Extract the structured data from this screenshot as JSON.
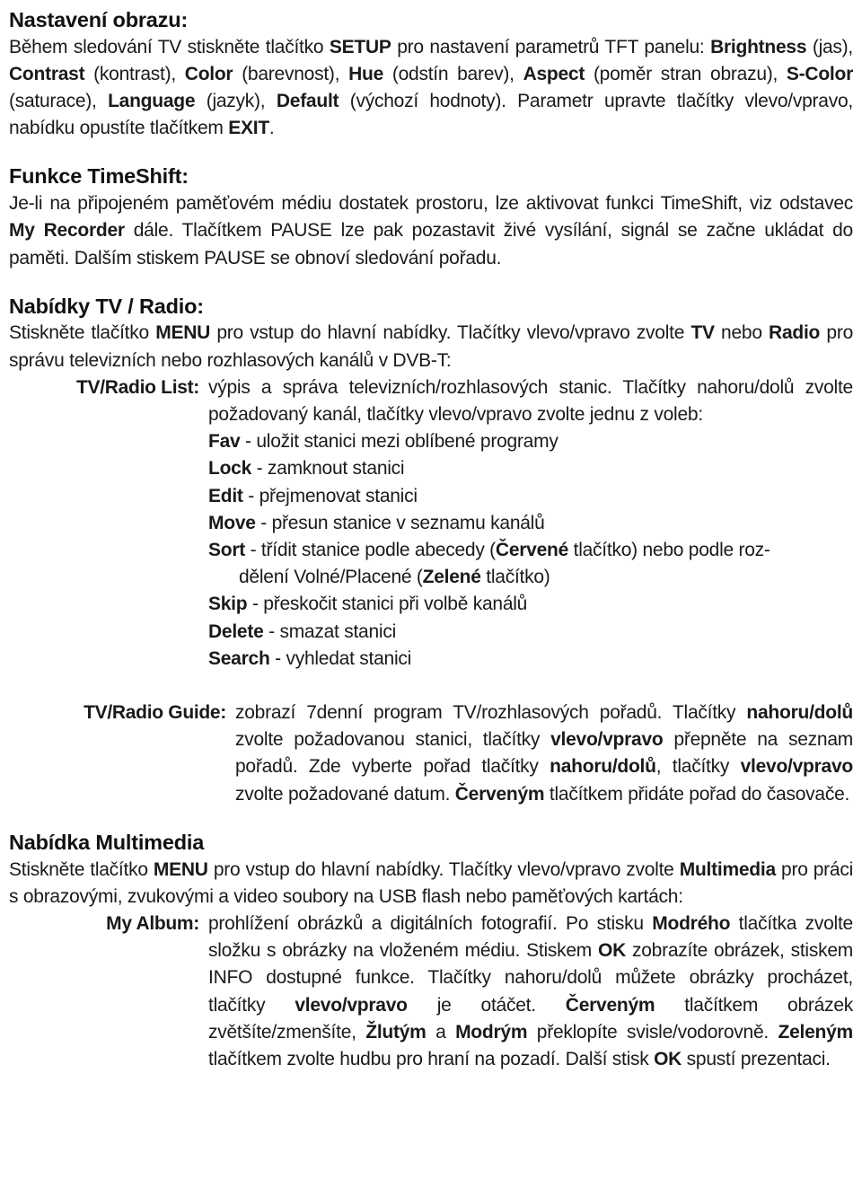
{
  "document": {
    "language": "cs",
    "background_color": "#ffffff",
    "text_color": "#1a1a1a"
  },
  "sections": {
    "picture_settings": {
      "heading": "Nastavení obrazu:",
      "body_parts": [
        {
          "text": "Během sledování TV stiskněte tlačítko ",
          "bold": false
        },
        {
          "text": "SETUP",
          "bold": true
        },
        {
          "text": " pro nastavení parametrů TFT panelu: ",
          "bold": false
        },
        {
          "text": "Brightness",
          "bold": true
        },
        {
          "text": " (jas), ",
          "bold": false
        },
        {
          "text": "Contrast",
          "bold": true
        },
        {
          "text": " (kontrast), ",
          "bold": false
        },
        {
          "text": "Color",
          "bold": true
        },
        {
          "text": " (barevnost), ",
          "bold": false
        },
        {
          "text": "Hue",
          "bold": true
        },
        {
          "text": " (odstín barev), ",
          "bold": false
        },
        {
          "text": "Aspect",
          "bold": true
        },
        {
          "text": " (poměr stran obrazu), ",
          "bold": false
        },
        {
          "text": "S-Color",
          "bold": true
        },
        {
          "text": " (saturace), ",
          "bold": false
        },
        {
          "text": "Language",
          "bold": true
        },
        {
          "text": " (jazyk), ",
          "bold": false
        },
        {
          "text": "Default",
          "bold": true
        },
        {
          "text": " (výchozí hodnoty). Parametr upravte tlačítky vlevo/vpravo, nabídku opustíte tlačítkem ",
          "bold": false
        },
        {
          "text": "EXIT",
          "bold": true
        },
        {
          "text": ".",
          "bold": false
        }
      ]
    },
    "timeshift": {
      "heading": "Funkce TimeShift:",
      "body_parts": [
        {
          "text": "Je-li na připojeném paměťovém médiu dostatek prostoru, lze aktivovat funkci TimeShift, viz odstavec ",
          "bold": false
        },
        {
          "text": "My Recorder",
          "bold": true
        },
        {
          "text": " dále. Tlačítkem PAUSE lze pak pozastavit živé vysílání, signál se začne ukládat do paměti. Dalším stiskem PAUSE se obnoví sledování pořadu.",
          "bold": false
        }
      ]
    },
    "tv_radio_menus": {
      "heading": "Nabídky TV / Radio:",
      "intro_parts": [
        {
          "text": "Stiskněte tlačítko ",
          "bold": false
        },
        {
          "text": "MENU",
          "bold": true
        },
        {
          "text": " pro vstup do hlavní nabídky. Tlačítky vlevo/vpravo zvolte ",
          "bold": false
        },
        {
          "text": "TV",
          "bold": true
        },
        {
          "text": " nebo ",
          "bold": false
        },
        {
          "text": "Radio",
          "bold": true
        },
        {
          "text": " pro správu televizních nebo rozhlasových kanálů v DVB-T:",
          "bold": false
        }
      ],
      "list_entry": {
        "label": "TV/Radio List:",
        "body_parts": [
          {
            "text": "výpis a správa televizních/rozhlasových stanic. Tlačítky nahoru/dolů zvolte požadovaný kanál, tlačítky vlevo/vpravo zvolte jednu z voleb:",
            "bold": false
          }
        ],
        "options": [
          {
            "name": "Fav",
            "desc": " - uložit stanici mezi oblíbené programy",
            "continuation": ""
          },
          {
            "name": "Lock",
            "desc": " - zamknout stanici",
            "continuation": ""
          },
          {
            "name": "Edit",
            "desc": " - přejmenovat stanici",
            "continuation": ""
          },
          {
            "name": "Move",
            "desc": " - přesun stanice v seznamu kanálů",
            "continuation": ""
          },
          {
            "name": "Sort",
            "desc": " - třídit stanice podle abecedy (Červené tlačítko) nebo podle roz-",
            "continuation": "dělení Volné/Placené (Zelené tlačítko)"
          },
          {
            "name": "Skip",
            "desc": " - přeskočit stanici při volbě kanálů",
            "continuation": ""
          },
          {
            "name": "Delete",
            "desc": " - smazat stanici",
            "continuation": ""
          },
          {
            "name": "Search",
            "desc": " - vyhledat stanici",
            "continuation": ""
          }
        ],
        "sort_bold_red": "Červené",
        "sort_bold_green": "Zelené"
      },
      "guide_entry": {
        "label": "TV/Radio Guide:",
        "body_parts": [
          {
            "text": "zobrazí 7denní program TV/rozhlasových pořadů. Tlačítky ",
            "bold": false
          },
          {
            "text": "nahoru/dolů",
            "bold": true
          },
          {
            "text": " zvolte požadovanou stanici, tlačítky ",
            "bold": false
          },
          {
            "text": "vlevo/vpravo",
            "bold": true
          },
          {
            "text": " přepněte na seznam pořadů. Zde vyberte pořad tlačítky ",
            "bold": false
          },
          {
            "text": "nahoru/dolů",
            "bold": true
          },
          {
            "text": ", tlačítky ",
            "bold": false
          },
          {
            "text": "vlevo/vpravo",
            "bold": true
          },
          {
            "text": " zvolte požadované datum. ",
            "bold": false
          },
          {
            "text": "Červeným",
            "bold": true
          },
          {
            "text": " tlačítkem přidáte pořad do časovače.",
            "bold": false
          }
        ]
      }
    },
    "multimedia": {
      "heading": "Nabídka Multimedia",
      "intro_parts": [
        {
          "text": "Stiskněte tlačítko ",
          "bold": false
        },
        {
          "text": "MENU",
          "bold": true
        },
        {
          "text": " pro vstup do hlavní nabídky. Tlačítky vlevo/vpravo zvolte ",
          "bold": false
        },
        {
          "text": "Multimedia",
          "bold": true
        },
        {
          "text": " pro práci s obrazovými, zvukovými a video soubory na USB flash nebo paměťových kartách:",
          "bold": false
        }
      ],
      "album_entry": {
        "label": "My Album:",
        "body_parts": [
          {
            "text": "prohlížení obrázků a digitálních fotografií. Po stisku ",
            "bold": false
          },
          {
            "text": "Modrého",
            "bold": true
          },
          {
            "text": " tlačítka zvolte složku s obrázky na vloženém médiu. Stiskem ",
            "bold": false
          },
          {
            "text": "OK",
            "bold": true
          },
          {
            "text": " zobrazíte obrázek, stiskem INFO dostupné funkce. Tlačítky nahoru/dolů můžete obrázky procházet, tlačítky ",
            "bold": false
          },
          {
            "text": "vlevo/vpravo",
            "bold": true
          },
          {
            "text": " je otáčet. ",
            "bold": false
          },
          {
            "text": "Červeným",
            "bold": true
          },
          {
            "text": " tlačítkem obrázek zvětšíte/zmenšíte, ",
            "bold": false
          },
          {
            "text": "Žlutým",
            "bold": true
          },
          {
            "text": " a ",
            "bold": false
          },
          {
            "text": "Modrým",
            "bold": true
          },
          {
            "text": " překlopíte svisle/vodorovně. ",
            "bold": false
          },
          {
            "text": "Zeleným",
            "bold": true
          },
          {
            "text": " tlačítkem zvolte hudbu pro hraní na pozadí. Další stisk ",
            "bold": false
          },
          {
            "text": "OK",
            "bold": true
          },
          {
            "text": " spustí prezentaci.",
            "bold": false
          }
        ]
      }
    }
  }
}
